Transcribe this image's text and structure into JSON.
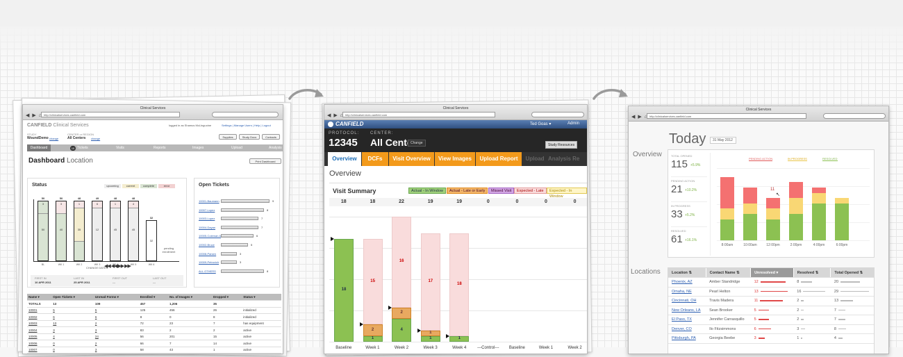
{
  "arrows": {
    "icon": "curved-arrow-icon"
  },
  "colors": {
    "canfield_blue": "#35588f",
    "orange": "#f39a1b",
    "green": "#8cc152",
    "red": "#ef6b6b",
    "yellow": "#f9d774",
    "pink": "#f9dcdc"
  },
  "w1": {
    "browser_title": "Clinical Services",
    "url": "http://clinicalservices.canfield.com",
    "logo_bold": "CANFIELD",
    "logo_light": " Clinical Services",
    "logged_in": "logged in as Shamus McLinguoine",
    "top_links": [
      "Settings",
      "Manage Users",
      "Help",
      "Logout"
    ],
    "study_label": "STUDY",
    "study_value": "WoundDemo",
    "study_change": "change",
    "center_label": "CENTER or REGION",
    "center_value": "All Centers",
    "center_change": "change",
    "btns": [
      "Supplies",
      "Study Docs",
      "Contacts"
    ],
    "tabs": [
      "Dashboard",
      "Tickets",
      "Visits",
      "Reports",
      "Images",
      "Upload",
      "Analysis"
    ],
    "tickets_badge": "10",
    "page_title": "Dashboard",
    "page_sub": "Location",
    "print_btn": "Print Dashboard",
    "status_title": "Status",
    "status_legend": [
      "upcoming",
      "current",
      "complete",
      "error"
    ],
    "bars": [
      {
        "label": "BL",
        "top": "50"
      },
      {
        "label": "WK 1",
        "top": "50"
      },
      {
        "label": "WK 2",
        "top": "48"
      },
      {
        "label": "WK 3",
        "top": "49"
      },
      {
        "label": "WK 4",
        "top": "48"
      },
      {
        "label": "WK 5",
        "top": "48"
      },
      {
        "label": "WK 6",
        "top": "32"
      }
    ],
    "bar_inner": [
      "50",
      "40",
      "35",
      "12",
      "45",
      "45",
      "32"
    ],
    "bar_small": [
      "3",
      "3",
      "1",
      "6",
      "1",
      "4"
    ],
    "pending": "pending enrollment",
    "change_dates": "CHANGE DATES",
    "first_in_label": "FIRST IN",
    "first_in": "10 APR 2011",
    "last_in_label": "LAST IN",
    "last_in": "25 APR 2011",
    "first_out_label": "FIRST OUT",
    "first_out": "---",
    "last_out_label": "LAST OUT",
    "last_out": "---",
    "open_tickets_title": "Open Tickets",
    "tickets": [
      {
        "name": "10001-Baumann",
        "val": "9"
      },
      {
        "name": "10007-Lopez",
        "val": "8"
      },
      {
        "name": "10003-Lupez",
        "val": "7"
      },
      {
        "name": "10004-Dayan",
        "val": "7"
      },
      {
        "name": "10005-Coleman A",
        "val": "6"
      },
      {
        "name": "10002-Bruce",
        "val": "5"
      },
      {
        "name": "10008-Parsen",
        "val": "3"
      },
      {
        "name": "10009-Petrovich",
        "val": "3"
      },
      {
        "name": "ALL OTHERS",
        "val": "8"
      }
    ],
    "table_headers": [
      "Name",
      "Open Tickets",
      "Unread Forms",
      "Enrolled",
      "No. of Images",
      "Dropped",
      "Status"
    ],
    "table_rows": [
      [
        "TOTALS",
        "13",
        "109",
        "457",
        "1,206",
        "35",
        ""
      ],
      [
        "10001",
        "5",
        "5",
        "125",
        "456",
        "26",
        "initialized"
      ],
      [
        "10002",
        "6",
        "6",
        "8",
        "0",
        "8",
        "initialized"
      ],
      [
        "10003",
        "13",
        "2",
        "72",
        "23",
        "7",
        "has equipment"
      ],
      [
        "10004",
        "3",
        "3",
        "83",
        "2",
        "2",
        "active"
      ],
      [
        "10005",
        "4",
        "24",
        "56",
        "201",
        "15",
        "active"
      ],
      [
        "10006",
        "0",
        "2",
        "66",
        "7",
        "14",
        "active"
      ],
      [
        "10007",
        "0",
        "3",
        "58",
        "43",
        "1",
        "active"
      ]
    ]
  },
  "w2": {
    "browser_title": "Clinical Services",
    "url": "http://clinicalservices.canfield.com",
    "logo": "CANFIELD",
    "user": "Ted Goas",
    "admin": "Admin",
    "protocol_label": "PROTOCOL:",
    "protocol": "12345",
    "center_label": "CENTER:",
    "center": "All Centers",
    "change": "Change",
    "study_resources": "Study Resources",
    "tabs": [
      "Overview",
      "DCFs",
      "Visit Overview",
      "View Images",
      "Upload Report",
      "Upload",
      "Analysis Re"
    ],
    "heading": "Overview",
    "chart_title": "Visit Summary",
    "legend": [
      "Actual - In Window",
      "Actual - Late or Early",
      "Missed Visit",
      "Expected - Late",
      "Expected - In Window"
    ],
    "totals": [
      "18",
      "18",
      "22",
      "19",
      "19",
      "0",
      "0",
      "0",
      "0"
    ],
    "chart_data": {
      "type": "bar",
      "categories": [
        "Baseline",
        "Week 1",
        "Week 2",
        "Week 3",
        "Week 4",
        "---Control---",
        "Baseline",
        "Week 1",
        "Week 2"
      ],
      "series": [
        {
          "name": "Actual - In Window",
          "values": [
            18,
            1,
            4,
            1,
            1,
            0,
            0,
            0,
            0
          ]
        },
        {
          "name": "Actual - Late or Early",
          "values": [
            0,
            2,
            2,
            1,
            0,
            0,
            0,
            0,
            0
          ]
        },
        {
          "name": "Expected - Late",
          "values": [
            0,
            15,
            16,
            17,
            18,
            0,
            0,
            0,
            0
          ]
        }
      ],
      "ylim": [
        0,
        22
      ]
    }
  },
  "w3": {
    "browser_title": "Clinical Services",
    "url": "http://clinicalservices.canfield.com",
    "today": "Today",
    "date": "31 May 2012",
    "overview": "Overview",
    "stats": [
      {
        "label": "TOTAL OPENED",
        "value": "115",
        "delta": "+5.9%"
      },
      {
        "label": "PENDING ACTION",
        "value": "21",
        "delta": "+10.2%"
      },
      {
        "label": "IN PROGRESS",
        "value": "33",
        "delta": "+5.2%"
      },
      {
        "label": "RESOLVED",
        "value": "61",
        "delta": "+16.1%"
      }
    ],
    "legend": [
      "PENDING ACTION",
      "IN PROGRESS",
      "RESOLVED"
    ],
    "chart_data": {
      "type": "bar",
      "categories": [
        "8:00am",
        "10:00am",
        "12:00pm",
        "2:00pm",
        "4:00pm",
        "6:00pm"
      ],
      "series": [
        {
          "name": "RESOLVED",
          "values": [
            4,
            5,
            4,
            5,
            7,
            7
          ]
        },
        {
          "name": "IN PROGRESS",
          "values": [
            2,
            2,
            2,
            3,
            2,
            1
          ]
        },
        {
          "name": "PENDING ACTION",
          "values": [
            6,
            3,
            2,
            3,
            1,
            0
          ]
        }
      ],
      "annotation": "11"
    },
    "locations": "Locations",
    "table_headers": [
      "Location",
      "Contact Name",
      "Unresolved",
      "Resolved",
      "Total Opened"
    ],
    "table_rows": [
      {
        "loc": "Phoenix, AZ",
        "contact": "Amber Standridge",
        "unres": "12",
        "res": "8",
        "tot": "20"
      },
      {
        "loc": "Omaha, NE",
        "contact": "Pearl Helton",
        "unres": "13",
        "res": "16",
        "tot": "29"
      },
      {
        "loc": "Cincinnati, OH",
        "contact": "Travis Madera",
        "unres": "11",
        "res": "2",
        "tot": "13"
      },
      {
        "loc": "New Orleans, LA",
        "contact": "Sean Brooker",
        "unres": "5",
        "res": "2",
        "tot": "7"
      },
      {
        "loc": "El Paso, TX",
        "contact": "Jennifer Carrasquillo",
        "unres": "5",
        "res": "2",
        "tot": "7"
      },
      {
        "loc": "Denver, CO",
        "contact": "Ilo Fitzsimmons",
        "unres": "6",
        "res": "3",
        "tot": "8"
      },
      {
        "loc": "Pittsburgh, PA",
        "contact": "Georgia Beebe",
        "unres": "3",
        "res": "1",
        "tot": "4"
      }
    ]
  }
}
